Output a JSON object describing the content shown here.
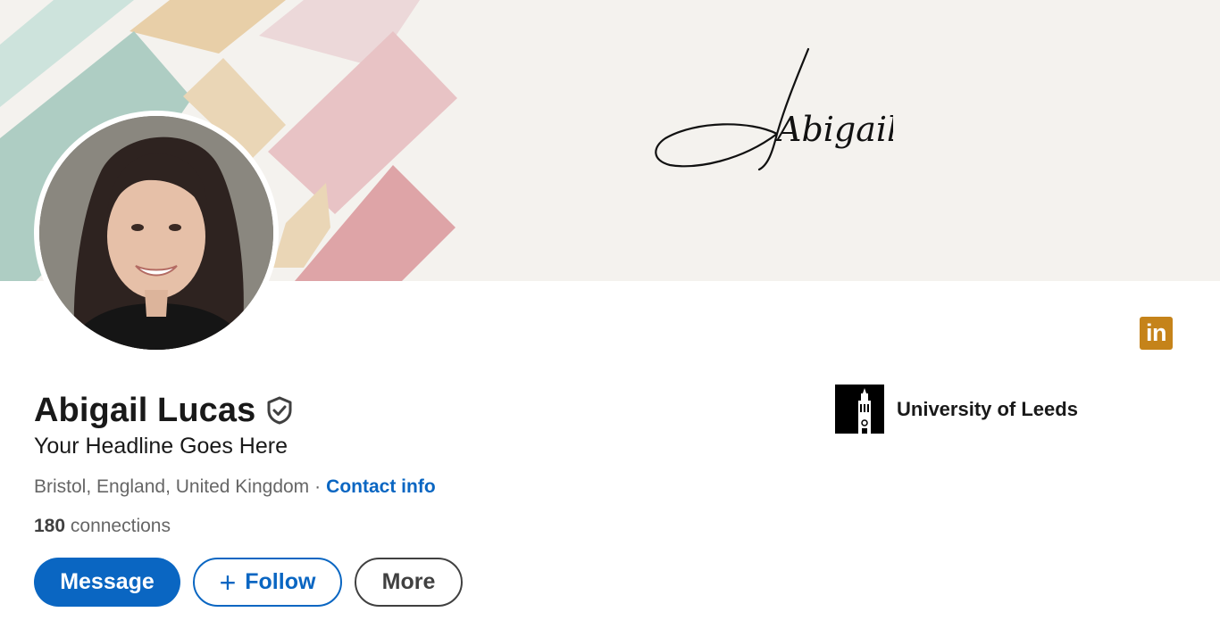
{
  "banner": {
    "signature_text": "Abigail",
    "colors": [
      "#cde3dc",
      "#aecdc3",
      "#e8cfa8",
      "#ead6b6",
      "#ecd8d9",
      "#e8c3c5",
      "#dea4a7"
    ]
  },
  "profile": {
    "name": "Abigail Lucas",
    "verified_icon": "verified-shield-check-icon",
    "headline": "Your Headline Goes Here",
    "location": "Bristol, England, United Kingdom",
    "separator": "·",
    "contact_link": "Contact info",
    "connections_count": "180",
    "connections_label": "connections"
  },
  "actions": {
    "message_label": "Message",
    "follow_icon": "+",
    "follow_label": "Follow",
    "more_label": "More"
  },
  "education": {
    "school": "University of Leeds",
    "logo_icon": "university-tower-icon"
  },
  "badge": {
    "icon": "linkedin-icon",
    "text": "in",
    "color": "#c5831a"
  },
  "theme": {
    "accent": "#0a66c2",
    "text_primary": "#191919",
    "text_secondary": "#666666"
  }
}
